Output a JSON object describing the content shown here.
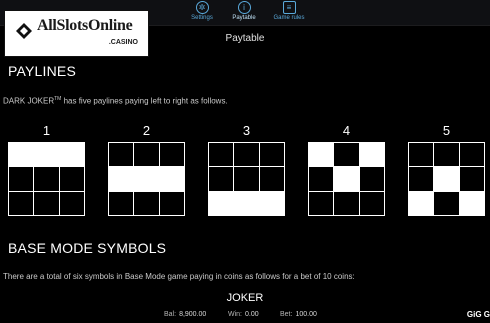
{
  "nav": {
    "items": [
      {
        "label": "Settings",
        "icon": "gear-icon",
        "active": false
      },
      {
        "label": "Paytable",
        "icon": "info-icon",
        "active": true
      },
      {
        "label": "Game rules",
        "icon": "rules-icon",
        "active": false
      }
    ]
  },
  "logo": {
    "title": "AllSlotsOnline",
    "subtitle": ".CASINO"
  },
  "page_title": "Paytable",
  "paylines": {
    "heading": "PAYLINES",
    "intro_prefix": "DARK JOKER",
    "intro_tm": "TM",
    "intro_suffix": " has five paylines paying left to right as follows.",
    "lines": [
      {
        "number": "1",
        "pattern": [
          1,
          1,
          1,
          0,
          0,
          0,
          0,
          0,
          0
        ]
      },
      {
        "number": "2",
        "pattern": [
          0,
          0,
          0,
          1,
          1,
          1,
          0,
          0,
          0
        ]
      },
      {
        "number": "3",
        "pattern": [
          0,
          0,
          0,
          0,
          0,
          0,
          1,
          1,
          1
        ]
      },
      {
        "number": "4",
        "pattern": [
          1,
          0,
          1,
          0,
          1,
          0,
          0,
          0,
          0
        ]
      },
      {
        "number": "5",
        "pattern": [
          0,
          0,
          0,
          0,
          1,
          0,
          1,
          0,
          1
        ]
      }
    ]
  },
  "base_mode": {
    "heading": "BASE MODE SYMBOLS",
    "intro": "There are a total of six symbols in Base Mode game paying in coins as follows for a bet of 10 coins:"
  },
  "symbol_name": "JOKER",
  "status": {
    "bal_label": "Bal:",
    "bal_value": "8,900.00",
    "win_label": "Win:",
    "win_value": "0.00",
    "bet_label": "Bet:",
    "bet_value": "100.00"
  },
  "brand": "GiG  G",
  "colors": {
    "accent": "#5aa9da",
    "background": "#000000",
    "cell_on": "#ffffff"
  }
}
